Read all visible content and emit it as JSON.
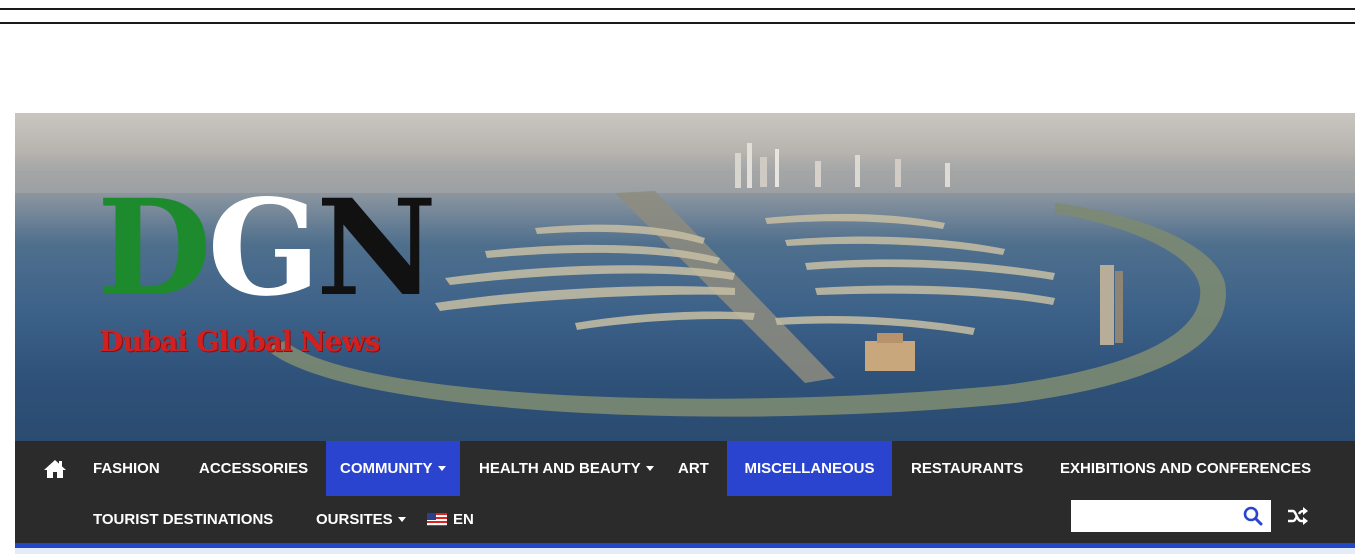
{
  "logo": {
    "letters": [
      "D",
      "G",
      "N"
    ],
    "tagline": "Dubai Global News",
    "colors": {
      "d": "#1e8a2e",
      "g": "#ffffff",
      "n": "#111111",
      "tagline": "#d21f1f"
    }
  },
  "nav": {
    "home_icon": "home-icon",
    "items_row1": [
      {
        "label": "FASHION",
        "active": false,
        "dropdown": false
      },
      {
        "label": "ACCESSORIES",
        "active": false,
        "dropdown": false
      },
      {
        "label": "COMMUNITY",
        "active": true,
        "dropdown": true
      },
      {
        "label": "HEALTH AND BEAUTY",
        "active": false,
        "dropdown": true
      },
      {
        "label": "ART",
        "active": false,
        "dropdown": false
      },
      {
        "label": "MISCELLANEOUS",
        "active": true,
        "dropdown": false
      },
      {
        "label": "RESTAURANTS",
        "active": false,
        "dropdown": false
      },
      {
        "label": "EXHIBITIONS AND CONFERENCES",
        "active": false,
        "dropdown": false
      }
    ],
    "items_row2": [
      {
        "label": "TOURIST DESTINATIONS",
        "dropdown": false
      },
      {
        "label": "OURSITES",
        "dropdown": true
      },
      {
        "label": "EN",
        "dropdown": false,
        "icon": "us-flag-icon"
      }
    ],
    "search": {
      "placeholder": "",
      "value": "",
      "icon": "search-icon"
    },
    "random_icon": "shuffle-icon",
    "colors": {
      "bar": "#2b2b2b",
      "active": "#2a44d0",
      "accent": "#2248c7"
    }
  }
}
